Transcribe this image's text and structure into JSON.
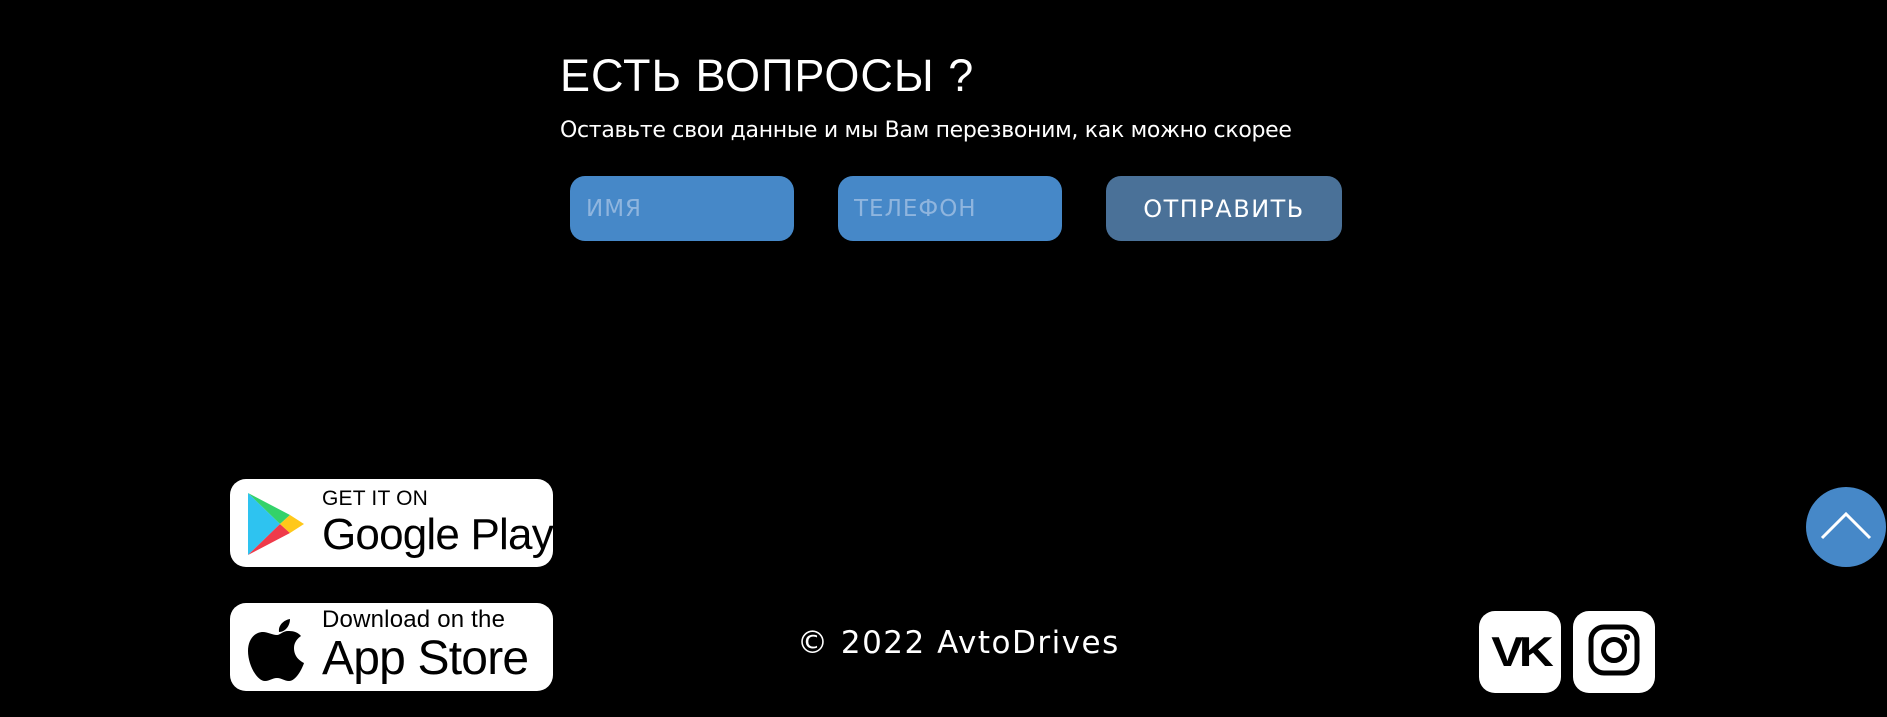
{
  "contact": {
    "title": "ЕСТЬ ВОПРОСЫ ?",
    "subtitle": "Оставьте свои данные и мы Вам перезвоним, как можно скорее",
    "name_placeholder": "ИМЯ",
    "phone_placeholder": "ТЕЛЕФОН",
    "name_value": "",
    "phone_value": "",
    "submit_label": "ОТПРАВИТЬ"
  },
  "apps": {
    "google": {
      "small": "GET IT ON",
      "big": "Google Play",
      "icon": "google-play-icon"
    },
    "apple": {
      "small": "Download on the",
      "big": "App Store",
      "icon": "apple-icon"
    }
  },
  "footer": {
    "copyright": "© 2022 AvtoDrives"
  },
  "social": {
    "vk_label": "VK",
    "vk_icon": "vk-icon",
    "instagram_icon": "instagram-icon"
  },
  "scroll_top_icon": "chevron-up-icon",
  "colors": {
    "background": "#000000",
    "input": "#4688c8",
    "button": "#4a7198",
    "scroll_top": "#4688c8"
  }
}
